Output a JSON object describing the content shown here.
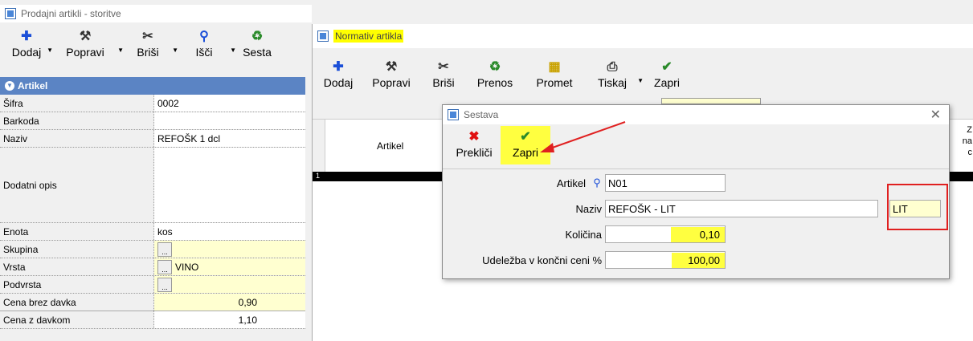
{
  "left_window": {
    "title": "Prodajni artikli - storitve",
    "toolbar": [
      {
        "label": "Dodaj",
        "icon": "plus-icon",
        "glyph": "✚"
      },
      {
        "label": "Popravi",
        "icon": "hammer-icon",
        "glyph": "⚒"
      },
      {
        "label": "Briši",
        "icon": "scissors-icon",
        "glyph": "✂"
      },
      {
        "label": "Išči",
        "icon": "magnifier-icon",
        "glyph": "⚲"
      },
      {
        "label": "Sesta",
        "icon": "recycle-icon",
        "glyph": "♻"
      }
    ],
    "section_title": "Artikel",
    "fields": [
      {
        "label": "Šifra",
        "value": "0002"
      },
      {
        "label": "Barkoda",
        "value": ""
      },
      {
        "label": "Naziv",
        "value": "REFOŠK 1 dcl"
      },
      {
        "label": "Dodatni opis",
        "value": ""
      },
      {
        "label": "Enota",
        "value": "kos"
      },
      {
        "label": "Skupina",
        "value": "..."
      },
      {
        "label": "Vrsta",
        "value": "VINO"
      },
      {
        "label": "Podvrsta",
        "value": "..."
      },
      {
        "label": "Cena brez davka",
        "value": "0,90"
      },
      {
        "label": "Cena z davkom",
        "value": "1,10"
      }
    ]
  },
  "normativ_window": {
    "title": "Normativ artikla",
    "toolbar": [
      {
        "label": "Dodaj",
        "icon": "plus-icon",
        "glyph": "✚"
      },
      {
        "label": "Popravi",
        "icon": "hammer-icon",
        "glyph": "⚒"
      },
      {
        "label": "Briši",
        "icon": "scissors-icon",
        "glyph": "✂"
      },
      {
        "label": "Prenos",
        "icon": "recycle-icon",
        "glyph": "♻"
      },
      {
        "label": "Promet",
        "icon": "boxes-icon",
        "glyph": "▦"
      },
      {
        "label": "Tiskaj",
        "icon": "printer-icon",
        "glyph": "⎙"
      },
      {
        "label": "Zapri",
        "icon": "checkmark-icon",
        "glyph": "✔"
      }
    ],
    "grid_header_artikel": "Artikel",
    "grid_header_right": "Z\nna\nc",
    "row_number": "1"
  },
  "sestava_dialog": {
    "title": "Sestava",
    "close_glyph": "✕",
    "toolbar": [
      {
        "label": "Prekliči",
        "icon": "cancel-x-icon",
        "glyph": "✖"
      },
      {
        "label": "Zapri",
        "icon": "checkmark-icon",
        "glyph": "✔"
      }
    ],
    "artikel_label": "Artikel",
    "artikel_value": "N01",
    "naziv_label": "Naziv",
    "naziv_value": "REFOŠK - LIT",
    "enota_value": "LIT",
    "kolicina_label": "Količina",
    "kolicina_value": "0,10",
    "udelezba_label": "Udeležba v končni ceni %",
    "udelezba_value": "100,00"
  },
  "colors": {
    "highlight": "#ffff00",
    "annotation_red": "#e02020",
    "section_blue": "#5b84c4"
  }
}
